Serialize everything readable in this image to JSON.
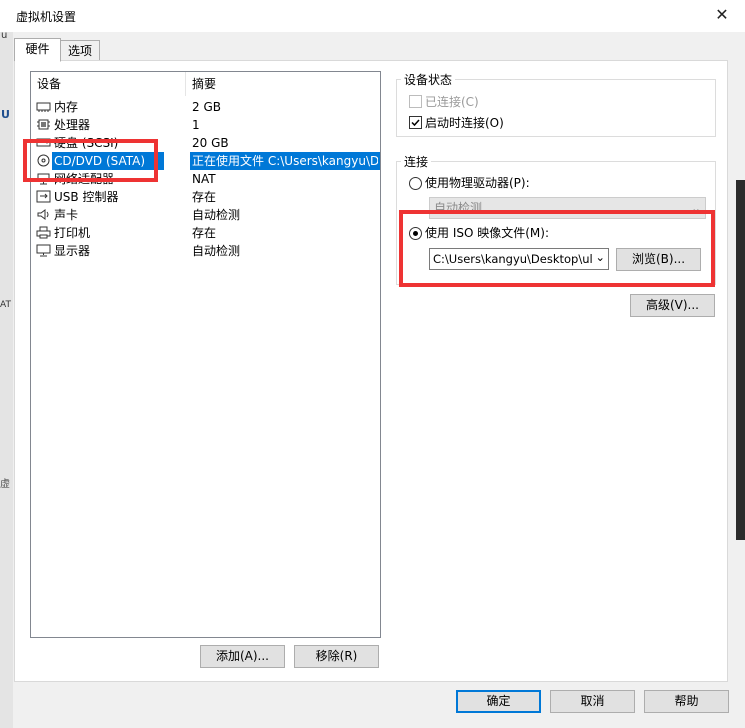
{
  "window": {
    "title": "虚拟机设置",
    "close_glyph": "✕"
  },
  "background_chars": {
    "c1": "u",
    "c2": "U",
    "c3": "AT",
    "c4": "虚"
  },
  "tabs": [
    {
      "label": "硬件"
    },
    {
      "label": "选项"
    }
  ],
  "device_list": {
    "col_device": "设备",
    "col_summary": "摘要",
    "rows": [
      {
        "name": "内存",
        "summary": "2 GB",
        "icon": "memory-icon"
      },
      {
        "name": "处理器",
        "summary": "1",
        "icon": "processor-icon"
      },
      {
        "name": "硬盘 (SCSI)",
        "summary": "20 GB",
        "icon": "hard-disk-icon"
      },
      {
        "name": "CD/DVD (SATA)",
        "summary": "正在使用文件 C:\\Users\\kangyu\\Desktop\\ub",
        "icon": "cd-dvd-icon"
      },
      {
        "name": "网络适配器",
        "summary": "NAT",
        "icon": "network-adapter-icon"
      },
      {
        "name": "USB 控制器",
        "summary": "存在",
        "icon": "usb-icon"
      },
      {
        "name": "声卡",
        "summary": "自动检测",
        "icon": "sound-card-icon"
      },
      {
        "name": "打印机",
        "summary": "存在",
        "icon": "printer-icon"
      },
      {
        "name": "显示器",
        "summary": "自动检测",
        "icon": "display-icon"
      }
    ],
    "selected_index": 3
  },
  "device_status": {
    "title": "设备状态",
    "connected_label": "已连接(C)",
    "connected_checked": false,
    "connect_on_start_label": "启动时连接(O)",
    "connect_on_start_checked": true
  },
  "connection": {
    "title": "连接",
    "physical_label": "使用物理驱动器(P):",
    "physical_value": "自动检测",
    "iso_label": "使用 ISO 映像文件(M):",
    "iso_value": "C:\\Users\\kangyu\\Desktop\\ul",
    "browse_label": "浏览(B)..."
  },
  "buttons": {
    "advanced": "高级(V)...",
    "add": "添加(A)...",
    "remove": "移除(R)",
    "ok": "确定",
    "cancel": "取消",
    "help": "帮助"
  },
  "colors": {
    "selection": "#0078d7",
    "highlight_box": "#ee3333"
  }
}
